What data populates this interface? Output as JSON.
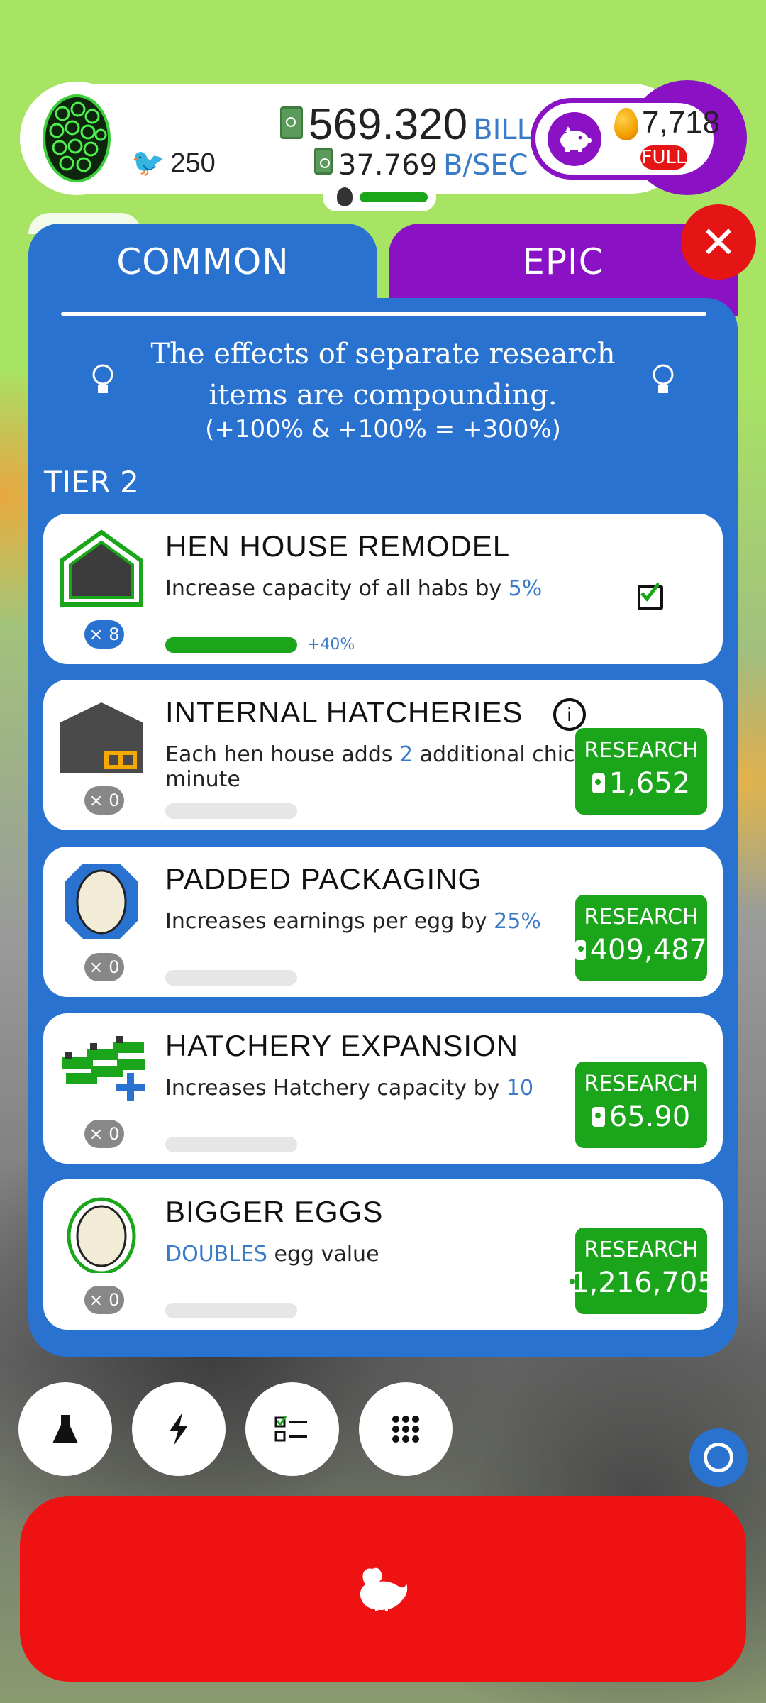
{
  "header": {
    "chicken_count": "250",
    "money_value": "569.320",
    "money_unit": "BILLION",
    "rate_value": "37.769",
    "rate_unit": "B/SEC",
    "golden_eggs": "7,718",
    "piggy_status": "FULL"
  },
  "tabs": [
    {
      "label": "COMMON",
      "active": true
    },
    {
      "label": "EPIC",
      "active": false
    }
  ],
  "info": {
    "line": "The effects of separate research items are compounding.",
    "example": "(+100% & +100% = +300%)"
  },
  "tier_label": "TIER 2",
  "research_items": [
    {
      "title": "HEN HOUSE REMODEL",
      "desc_pre": "Increase capacity of all habs by ",
      "desc_hl": "5%",
      "desc_post": "",
      "level": "× 8",
      "bonus": "+40%",
      "button": null,
      "completed": true
    },
    {
      "title": "INTERNAL HATCHERIES",
      "desc_pre": "Each hen house adds ",
      "desc_hl": "2",
      "desc_post": " additional chickens per minute",
      "level": "× 0",
      "button": {
        "label": "RESEARCH",
        "cost": "1,652"
      }
    },
    {
      "title": "PADDED PACKAGING",
      "desc_pre": "Increases earnings per egg by ",
      "desc_hl": "25%",
      "desc_post": "",
      "level": "× 0",
      "button": {
        "label": "RESEARCH",
        "cost": "409,487"
      }
    },
    {
      "title": "HATCHERY EXPANSION",
      "desc_pre": "Increases Hatchery capacity by ",
      "desc_hl": "10",
      "desc_post": "",
      "level": "× 0",
      "button": {
        "label": "RESEARCH",
        "cost": "65.90"
      }
    },
    {
      "title": "BIGGER EGGS",
      "desc_pre": "",
      "desc_hl": "DOUBLES",
      "desc_post": " egg value",
      "level": "× 0",
      "button": {
        "label": "RESEARCH",
        "cost": "1,216,705"
      }
    }
  ],
  "bottom_nav": [
    "flask-icon",
    "lightning-icon",
    "checklist-icon",
    "grid-icon"
  ],
  "colors": {
    "accent_blue": "#2a72d0",
    "epic_purple": "#8a12c4",
    "research_green": "#1aa51a",
    "hatch_red": "#ee1212"
  }
}
